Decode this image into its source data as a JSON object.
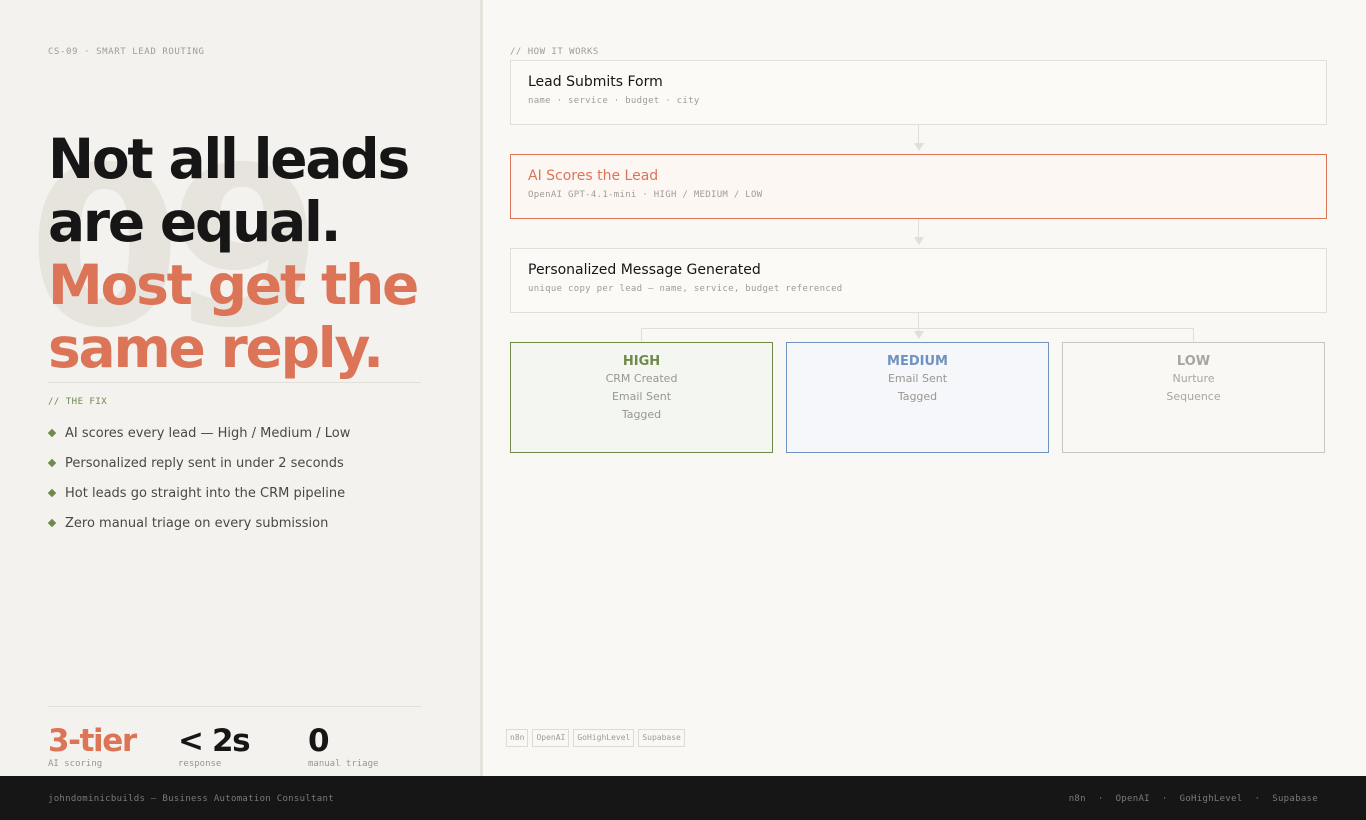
{
  "left": {
    "eyebrow": "CS-09  ·  SMART LEAD ROUTING",
    "bg_number": "09",
    "headline": {
      "line1": "Not all leads",
      "line2": "are equal.",
      "line3": "Most get the",
      "line4": "same reply."
    },
    "fix_label": "// THE FIX",
    "fix_items": [
      "AI scores every lead — High / Medium / Low",
      "Personalized reply sent in under 2 seconds",
      "Hot leads go straight into the CRM pipeline",
      "Zero manual triage on every submission"
    ],
    "stats": [
      {
        "value": "3-tier",
        "label": "AI scoring"
      },
      {
        "value": "< 2s",
        "label": "response"
      },
      {
        "value": "0",
        "label": "manual triage"
      }
    ]
  },
  "right": {
    "label": "// HOW IT WORKS",
    "steps": [
      {
        "title": "Lead Submits Form",
        "sub": "name  ·  service  ·  budget  ·  city"
      },
      {
        "title": "AI Scores the Lead",
        "sub": "OpenAI GPT-4.1-mini  ·  HIGH / MEDIUM / LOW"
      },
      {
        "title": "Personalized Message Generated",
        "sub": "unique copy per lead — name, service, budget referenced"
      }
    ],
    "tiers": {
      "high": {
        "title": "HIGH",
        "items": [
          "CRM Created",
          "Email Sent",
          "Tagged"
        ]
      },
      "medium": {
        "title": "MEDIUM",
        "items": [
          "Email Sent",
          "Tagged"
        ]
      },
      "low": {
        "title": "LOW",
        "items": [
          "Nurture",
          "Sequence"
        ]
      }
    },
    "tags": [
      "n8n",
      "OpenAI",
      "GoHighLevel",
      "Supabase"
    ]
  },
  "footer": {
    "left": "johndominicbuilds — Business Automation Consultant",
    "right": [
      "n8n",
      "OpenAI",
      "GoHighLevel",
      "Supabase"
    ]
  },
  "colors": {
    "accent": "#dc7457",
    "green": "#6f8a4a",
    "blue": "#6f93c0",
    "dark": "#161616"
  }
}
